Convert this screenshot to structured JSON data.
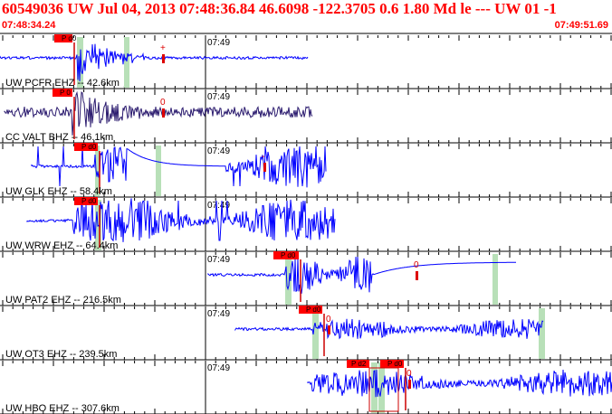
{
  "header": {
    "title": "60549036 UW Jul 04, 2013 07:48:36.84   46.6098 -122.3705  0.6 1.80 Md le --- UW 01  -1",
    "time_start": "07:48:34.24",
    "time_end": "07:49:51.69"
  },
  "colors": {
    "title": "#ff0000",
    "waveform": "#0000ff",
    "waveform_dark": "#2a1a6e",
    "pick_flag": "#ff0000",
    "green_band": "#b8e0b8"
  },
  "minute_label": "07:49",
  "traces": [
    {
      "label": "UW PCFR EHZ -- 42.6km",
      "pick_label": "P d0",
      "aux_mark": "+"
    },
    {
      "label": "CC VALT BHZ -- 46.1km",
      "pick_label": "P 0",
      "aux_mark": "0"
    },
    {
      "label": "UW GLK EHZ -- 58.4km",
      "pick_label": "P d0",
      "aux_mark": "-"
    },
    {
      "label": "UW WRW EHZ -- 64.4km",
      "pick_label": "P d0",
      "aux_mark": ""
    },
    {
      "label": "UW PAT2 EHZ -- 216.5km",
      "pick_label": "P d0",
      "aux_mark": "0"
    },
    {
      "label": "UW OT3 EHZ -- 239.5km",
      "pick_label": "P d0",
      "aux_mark": "0"
    },
    {
      "label": "UW HBO EHZ -- 307.6km",
      "pick_label": "P d0",
      "pick_label_2": "P d2",
      "aux_mark": "0"
    }
  ]
}
